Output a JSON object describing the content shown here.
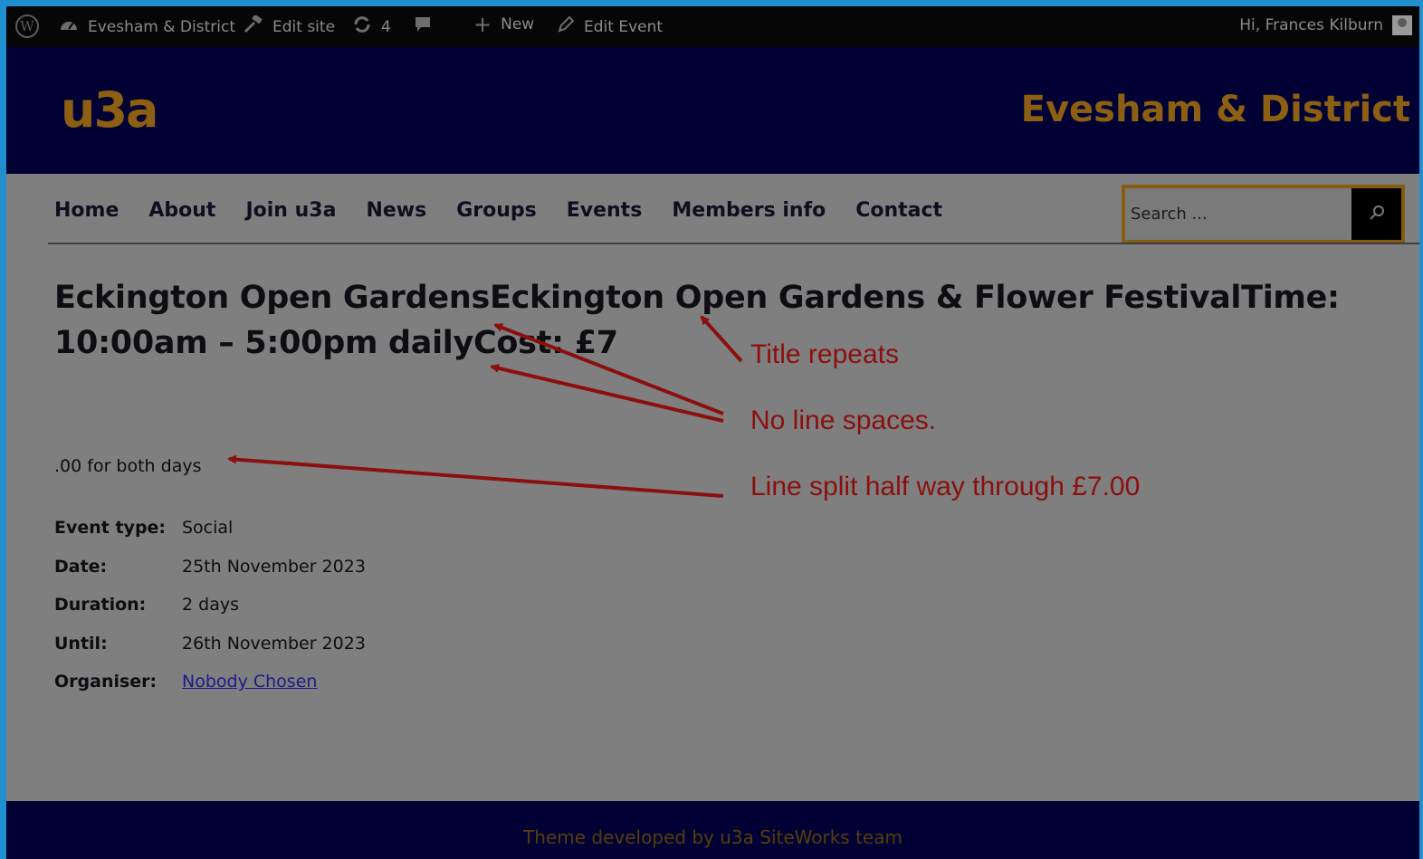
{
  "admin_bar": {
    "site_name": "Evesham & District",
    "edit_site": "Edit site",
    "updates_count": "4",
    "new_label": "New",
    "edit_event": "Edit Event",
    "greeting": "Hi, Frances Kilburn"
  },
  "header": {
    "logo": "u3a",
    "site_title": "Evesham & District"
  },
  "nav": {
    "items": [
      "Home",
      "About",
      "Join u3a",
      "News",
      "Groups",
      "Events",
      "Members info",
      "Contact"
    ]
  },
  "search": {
    "placeholder": "Search ..."
  },
  "event": {
    "title": "Eckington Open GardensEckington Open Gardens & Flower FestivalTime: 10:00am – 5:00pm dailyCost: £7",
    "description": ".00 for both days",
    "details": [
      {
        "label": "Event type:",
        "value": "Social"
      },
      {
        "label": "Date:",
        "value": "25th November 2023"
      },
      {
        "label": "Duration:",
        "value": "2 days"
      },
      {
        "label": "Until:",
        "value": "26th November 2023"
      },
      {
        "label": "Organiser:",
        "value": "Nobody Chosen"
      }
    ]
  },
  "annotations": {
    "title_repeats": "Title repeats",
    "no_line_spaces": "No line spaces.",
    "line_split": "Line split half way through £7.00"
  },
  "footer": {
    "text": "Theme developed by u3a SiteWorks team"
  },
  "colors": {
    "accent": "#8d5f12",
    "header_bg": "#000034",
    "annotation": "#8b0f0f"
  }
}
